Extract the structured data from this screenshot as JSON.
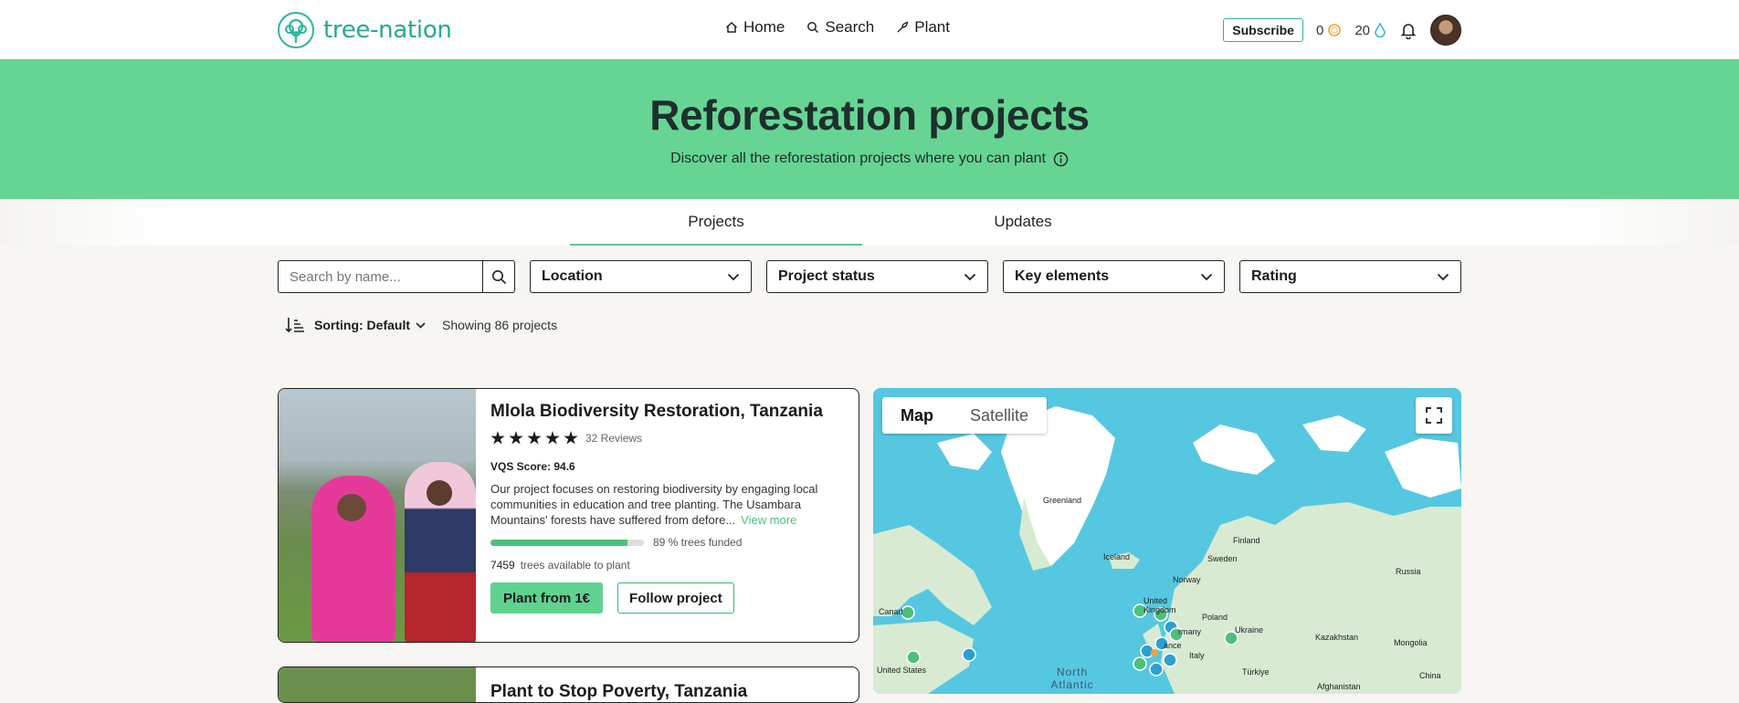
{
  "header": {
    "logo_text": "tree-nation",
    "nav": [
      {
        "label": "Home",
        "icon": "home-icon"
      },
      {
        "label": "Search",
        "icon": "search-icon"
      },
      {
        "label": "Plant",
        "icon": "plant-icon"
      }
    ],
    "subscribe_label": "Subscribe",
    "coins": "0",
    "drops": "20"
  },
  "hero": {
    "title": "Reforestation projects",
    "subtitle": "Discover all the reforestation projects where you can plant"
  },
  "tabs": [
    {
      "label": "Projects",
      "active": true
    },
    {
      "label": "Updates",
      "active": false
    }
  ],
  "filters": {
    "search_placeholder": "Search by name...",
    "selects": [
      "Location",
      "Project status",
      "Key elements",
      "Rating"
    ]
  },
  "sorting": {
    "label": "Sorting: Default",
    "showing": "Showing 86 projects"
  },
  "project": {
    "title": "Mlola Biodiversity Restoration, Tanzania",
    "rating": 5,
    "reviews": "32 Reviews",
    "vqs": "VQS Score: 94.6",
    "description": "Our project focuses on restoring biodiversity by engaging local communities in education and tree planting. The Usambara Mountains' forests have suffered from defore...",
    "view_more": "View more",
    "funded_percent": 89,
    "funded_text": "89 % trees funded",
    "trees_available": "7459",
    "trees_available_text": "trees available to plant",
    "plant_button": "Plant from 1€",
    "follow_button": "Follow project"
  },
  "project2": {
    "title": "Plant to Stop Poverty, Tanzania"
  },
  "map": {
    "toggle": [
      "Map",
      "Satellite"
    ],
    "labels": [
      "Greenland",
      "Iceland",
      "Finland",
      "Sweden",
      "Norway",
      "Russia",
      "United Kingdom",
      "Poland",
      "Ukraine",
      "Kazakhstan",
      "Mongolia",
      "Italy",
      "Türkiye",
      "China",
      "Afghanistan",
      "Canada",
      "United States",
      "North Atlantic",
      "ance",
      "rmany"
    ],
    "colors": {
      "water": "#56c7e0",
      "land": "#d8ead2",
      "ice": "#ffffff",
      "green_marker": "#4cc07a",
      "blue_marker": "#2c9fd3",
      "orange_marker": "#f3a531"
    }
  },
  "colors": {
    "accent": "#66d594",
    "brand": "#27a98e"
  }
}
